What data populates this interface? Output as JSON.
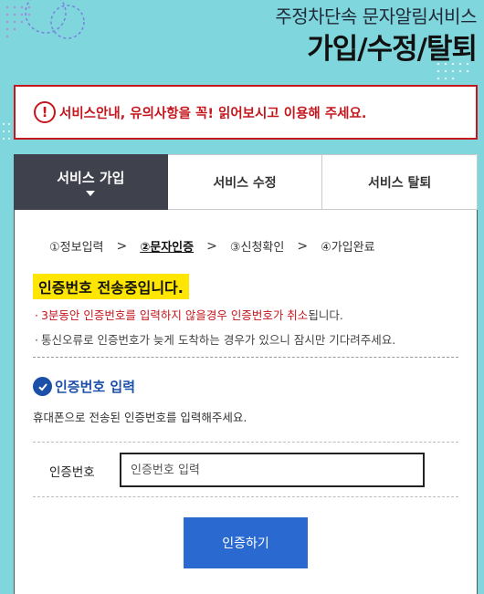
{
  "header": {
    "subtitle": "주정차단속 문자알림서비스",
    "title": "가입/수정/탈퇴"
  },
  "notice": {
    "icon": "exclamation-circle-icon",
    "text": "서비스안내, 유의사항을 꼭! 읽어보시고 이용해 주세요."
  },
  "tabs": [
    {
      "label": "서비스 가입",
      "active": true
    },
    {
      "label": "서비스 수정",
      "active": false
    },
    {
      "label": "서비스 탈퇴",
      "active": false
    }
  ],
  "steps": [
    {
      "label": "①정보입력",
      "current": false
    },
    {
      "label": "②문자인증",
      "current": true
    },
    {
      "label": "③신청확인",
      "current": false
    },
    {
      "label": "④가입완료",
      "current": false
    }
  ],
  "step_separator": ">",
  "sending": {
    "title": "인증번호 전송중입니다.",
    "bullet": "·",
    "info_1_red": "3분동안 인증번호를 입력하지 않을경우 인증번호가 취소",
    "info_1_rest": "됩니다.",
    "info_2": "통신오류로 인증번호가 늦게 도착하는 경우가 있으니 잠시만 기다려주세요."
  },
  "verify_section": {
    "title": "인증번호 입력",
    "description": "휴대폰으로 전송된 인증번호를 입력해주세요.",
    "field_label": "인증번호",
    "input_value": "",
    "input_placeholder": "인증번호 입력",
    "button_label": "인증하기"
  },
  "colors": {
    "background": "#7fd6dc",
    "accent_red": "#c4161c",
    "active_tab": "#3f414c",
    "highlight_yellow": "#ffe600",
    "primary_blue": "#2a6ad0",
    "section_blue": "#1b4fa8"
  }
}
